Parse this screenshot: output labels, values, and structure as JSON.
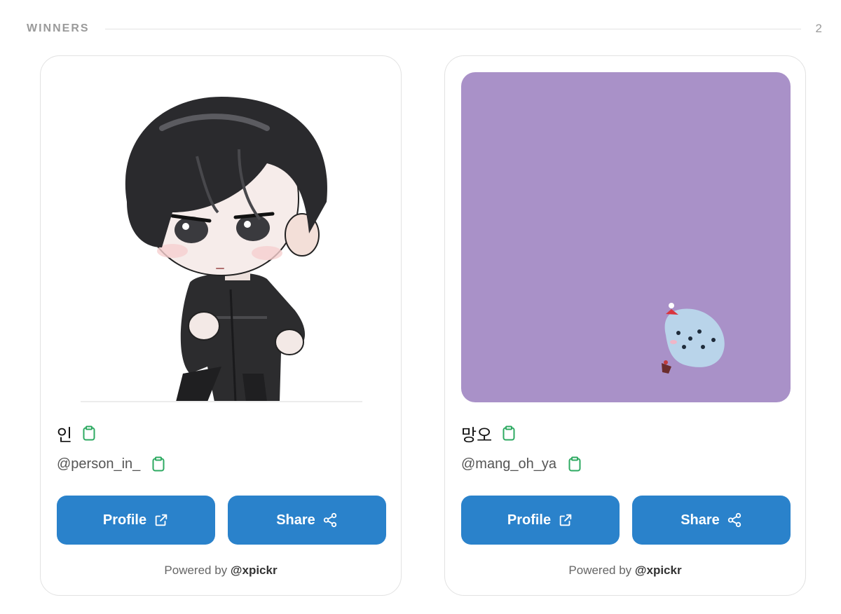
{
  "section": {
    "title": "WINNERS",
    "count": "2"
  },
  "colors": {
    "button": "#2a82cb",
    "clipboard_icon": "#2eaa62",
    "purple_bg": "#a991c8"
  },
  "winners": [
    {
      "name": "인",
      "handle": "@person_in_",
      "image": "chibi-character-illustration",
      "profile_label": "Profile",
      "share_label": "Share",
      "powered_prefix": "Powered by",
      "powered_brand": "@xpickr"
    },
    {
      "name": "망오",
      "handle": "@mang_oh_ya",
      "image": "purple-background-small-blue-creature",
      "profile_label": "Profile",
      "share_label": "Share",
      "powered_prefix": "Powered by",
      "powered_brand": "@xpickr"
    }
  ],
  "icons": {
    "copy": "clipboard-icon",
    "profile": "external-link-icon",
    "share": "share-icon"
  }
}
